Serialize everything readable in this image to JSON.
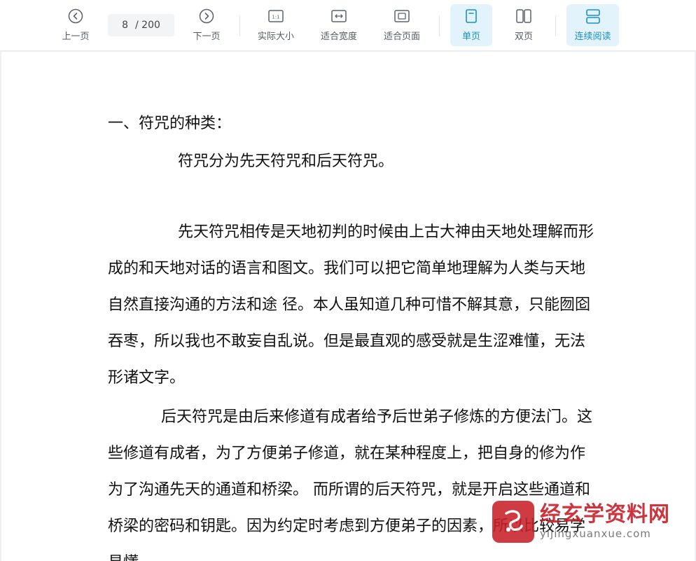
{
  "toolbar": {
    "prev_label": "上一页",
    "current_page": "8",
    "total_pages": "/ 200",
    "next_label": "下一页",
    "actual_size_label": "实际大小",
    "fit_width_label": "适合宽度",
    "fit_page_label": "适合页面",
    "single_page_label": "单页",
    "double_page_label": "双页",
    "continuous_label": "连续阅读",
    "accent_color": "#1b8fc9",
    "active_bg": "#e3f3fb",
    "icons": {
      "prev": "chevron-left-circle-icon",
      "next": "chevron-right-circle-icon",
      "actual_size": "one-to-one-icon",
      "fit_width": "fit-width-icon",
      "fit_page": "fit-page-icon",
      "single_page": "single-page-icon",
      "double_page": "double-page-icon",
      "continuous": "continuous-scroll-icon"
    }
  },
  "document": {
    "heading": "一、符咒的种类：",
    "subline": "符咒分为先天符咒和后天符咒。",
    "paragraph1": "先天符咒相传是天地初判的时候由上古大神由天地处理解而形成的和天地对话的语言和图文。我们可以把它简单地理解为人类与天地自然直接沟通的方法和途  径。本人虽知道几种可惜不解其意，只能囫囵吞枣，所以我也不敢妄自乱说。但是最直观的感受就是生涩难懂，无法形诸文字。",
    "paragraph2": "后天符咒是由后来修道有成者给予后世弟子修炼的方便法门。这些修道有成者，为了方便弟子修道，就在某种程度上，把自身的修为作为了沟通先天的通道和桥梁。  而所谓的后天符咒，就是开启这些通道和桥梁的密码和钥匙。因为约定时考虑到方便弟子的因素，所以比较易学易懂。"
  },
  "watermark": {
    "title": "经玄学资料网",
    "url": "yijingxuanxue.com",
    "color": "#c8202a"
  }
}
